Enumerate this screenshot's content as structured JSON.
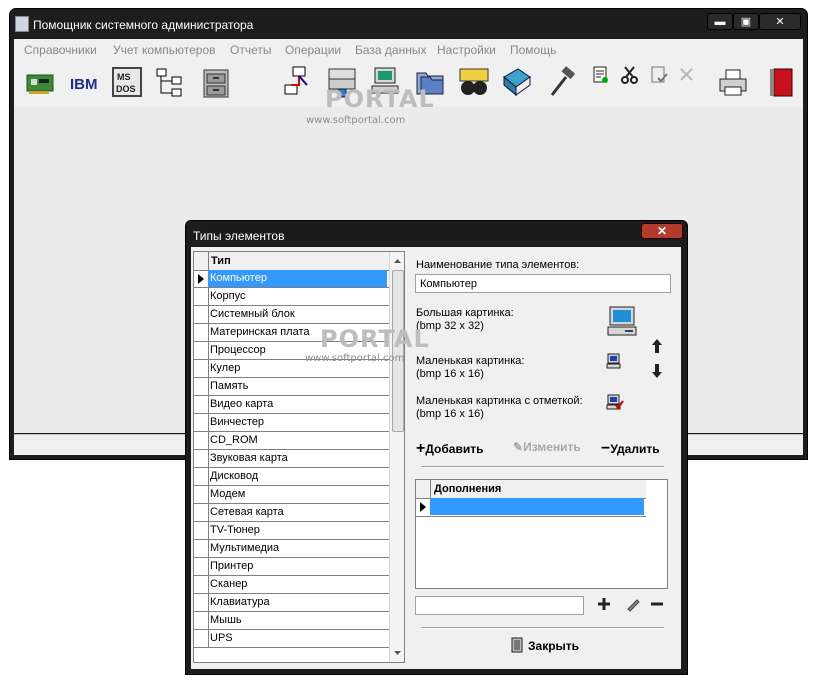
{
  "main_window": {
    "title": "Помощник системного администратора",
    "caption_buttons": {
      "minimize": "▬",
      "maximize": "▣",
      "close": "✕"
    },
    "menu": [
      "Справочники",
      "Учет компьютеров",
      "Отчеты",
      "Операции",
      "База данных",
      "Настройки",
      "Помощь"
    ],
    "toolbar_icons": [
      "network-card-icon",
      "ibm-icon",
      "ms-dos-icon",
      "tree-icon",
      "cabinet-icon",
      "network-computers-icon",
      "server-icon",
      "monitor-computer-icon",
      "folders-icon",
      "binoculars-icon",
      "book-icon",
      "hammer-icon",
      "doc-settings-icon",
      "scissors-icon",
      "doc-check-icon",
      "delete-x-icon",
      "printer-icon",
      "exit-door-icon"
    ],
    "toolbar_ibm_text": "IBM",
    "toolbar_msdos_text": "MS DOS"
  },
  "dialog": {
    "title": "Типы элементов",
    "close_glyph": "✕",
    "grid": {
      "header": "Тип",
      "rows": [
        "Компьютер",
        "Корпус",
        "Системный блок",
        "Материнская плата",
        "Процессор",
        "Кулер",
        "Память",
        "Видео карта",
        "Винчестер",
        "CD_ROM",
        "Звуковая карта",
        "Дисковод",
        "Модем",
        "Сетевая карта",
        "TV-Тюнер",
        "Мультимедиа",
        "Принтер",
        "Сканер",
        "Клавиатура",
        "Мышь",
        "UPS"
      ],
      "selected_index": 0
    },
    "name_label": "Наименование типа элементов:",
    "name_value": "Компьютер",
    "big_picture_label": "Большая картинка:",
    "big_picture_size": "(bmp 32 x 32)",
    "small_picture_label": "Маленькая картинка:",
    "small_picture_size": "(bmp 16 x 16)",
    "small_check_picture_label": "Маленькая картинка с отметкой:",
    "small_check_picture_size": "(bmp 16 x 16)",
    "add_button": "Добавить",
    "edit_button": "Изменить",
    "delete_button": "Удалить",
    "additions_header": "Дополнения",
    "close_button": "Закрыть"
  },
  "watermark": {
    "brand": "PORTAL",
    "url": "www.softportal.com"
  },
  "colors": {
    "selection": "#3399ff",
    "title_bar": "#1d1d1d",
    "close_red": "#b23b2c"
  }
}
